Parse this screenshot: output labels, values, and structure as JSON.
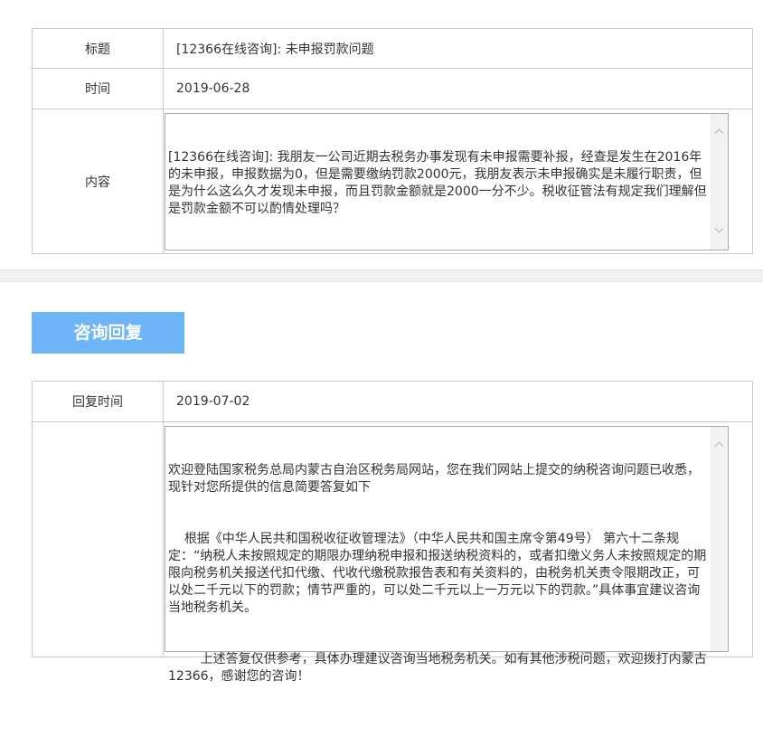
{
  "question": {
    "title_label": "标题",
    "title_value": "[12366在线咨询]: 未申报罚款问题",
    "time_label": "时间",
    "time_value": "2019-06-28",
    "content_label": "内容",
    "content_text": "[12366在线咨询]: 我朋友一公司近期去税务办事发现有未申报需要补报，经查是发生在2016年的未申报，申报数据为0，但是需要缴纳罚款2000元，我朋友表示未申报确实是未履行职责，但是为什么这么久才发现未申报，而且罚款金额就是2000一分不少。税收征管法有规定我们理解但是罚款金额不可以酌情处理吗？"
  },
  "reply_tab": {
    "label": "咨询回复"
  },
  "reply": {
    "time_label": "回复时间",
    "time_value": "2019-07-02",
    "content_lines": [
      "欢迎登陆国家税务总局内蒙古自治区税务局网站，您在我们网站上提交的纳税咨询问题已收悉，现针对您所提供的信息简要答复如下",
      "    根据《中华人民共和国税收征收管理法》（中华人民共和国主席令第49号） 第六十二条规定：“纳税人未按照规定的期限办理纳税申报和报送纳税资料的，或者扣缴义务人未按照规定的期限向税务机关报送代扣代缴、代收代缴税款报告表和有关资料的，由税务机关责令限期改正，可以处二千元以下的罚款；情节严重的，可以处二千元以上一万元以下的罚款。”具体事宜建议咨询当地税务机关。",
      "        上述答复仅供参考，具体办理建议咨询当地税务机关。如有其他涉税问题，欢迎拨打内蒙古12366，感谢您的咨询！"
    ]
  }
}
